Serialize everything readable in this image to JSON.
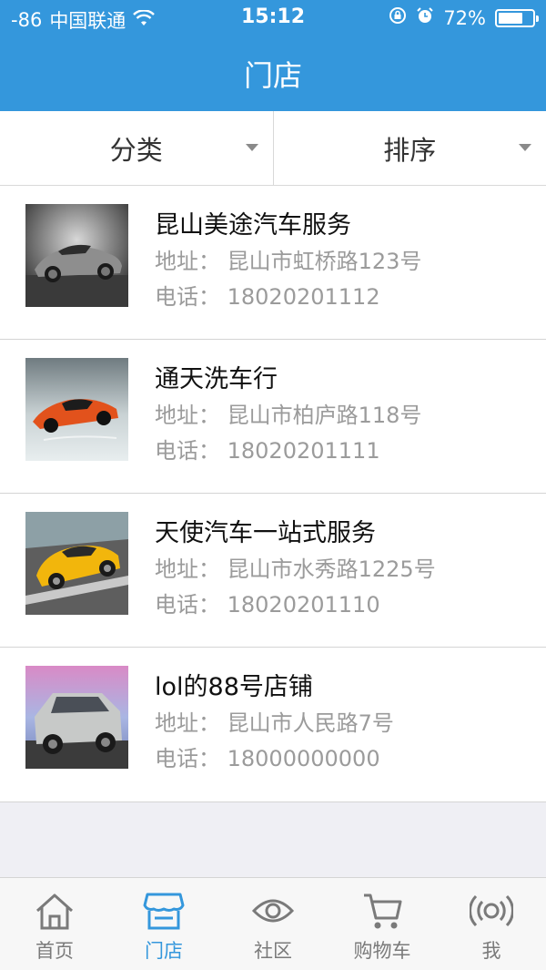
{
  "status_bar": {
    "signal": "-86",
    "carrier": "中国联通",
    "time": "15:12",
    "battery": "72%",
    "battery_level": 0.72
  },
  "header": {
    "title": "门店"
  },
  "filters": {
    "category": "分类",
    "sort": "排序"
  },
  "stores": [
    {
      "name": "昆山美途汽车服务",
      "address": "地址：  昆山市虹桥路123号",
      "phone": "电话：  18020201112"
    },
    {
      "name": "通天洗车行",
      "address": "地址：  昆山市柏庐路118号",
      "phone": "电话：  18020201111"
    },
    {
      "name": "天使汽车一站式服务",
      "address": "地址：  昆山市水秀路1225号",
      "phone": "电话：  18020201110"
    },
    {
      "name": "lol的88号店铺",
      "address": "地址：  昆山市人民路7号",
      "phone": "电话：  18000000000"
    }
  ],
  "tabbar": {
    "items": [
      {
        "label": "首页",
        "icon": "home-icon"
      },
      {
        "label": "门店",
        "icon": "store-icon",
        "active": true
      },
      {
        "label": "社区",
        "icon": "eye-icon"
      },
      {
        "label": "购物车",
        "icon": "cart-icon"
      },
      {
        "label": "我",
        "icon": "broadcast-icon"
      }
    ]
  },
  "colors": {
    "accent": "#3497dc",
    "background": "#efeff4",
    "muted_text": "#9b9b9b"
  }
}
